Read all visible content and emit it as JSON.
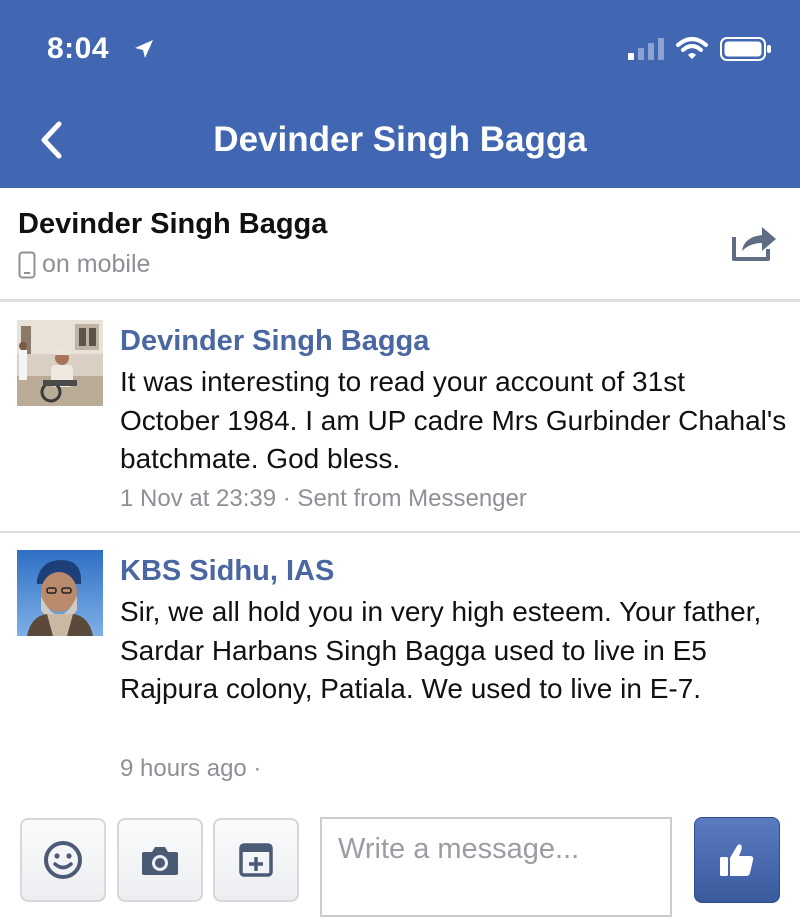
{
  "status_bar": {
    "time": "8:04"
  },
  "nav": {
    "title": "Devinder Singh Bagga"
  },
  "header": {
    "name": "Devinder Singh Bagga",
    "status": "on mobile"
  },
  "messages": [
    {
      "sender": "Devinder Singh Bagga",
      "text": "It was interesting to read your account of 31st October 1984. I am UP cadre Mrs Gurbinder Chahal's batchmate. God bless.",
      "meta": "1 Nov at 23:39 · Sent from Messenger"
    },
    {
      "sender": "KBS Sidhu, IAS",
      "text": "Sir, we all hold you in very high esteem. Your father, Sardar Harbans Singh Bagga used to live in E5 Rajpura colony, Patiala. We used to live in E-7.",
      "meta": "9 hours ago ·"
    }
  ],
  "composer": {
    "placeholder": "Write a message..."
  },
  "icons": [
    "location-arrow-icon",
    "signal-icon",
    "wifi-icon",
    "battery-icon",
    "back-chevron-icon",
    "phone-icon",
    "share-icon",
    "emoji-icon",
    "camera-icon",
    "sticker-icon",
    "thumbs-up-icon"
  ],
  "colors": {
    "brand_bar": "#4267b2",
    "sender_name": "#4b67a1",
    "meta_text": "#8d9096",
    "like_button": "#3f5fa5"
  }
}
